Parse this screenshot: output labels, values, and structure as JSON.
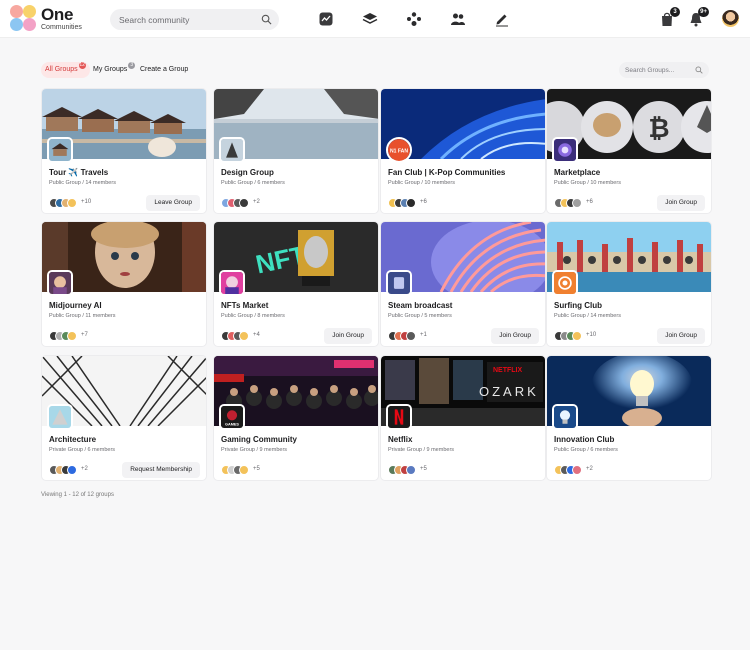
{
  "brand": {
    "name": "One",
    "subtitle": "Communities"
  },
  "search": {
    "placeholder": "Search community"
  },
  "nav_icons": [
    "activity-icon",
    "stack-icon",
    "members-icon",
    "groups-icon",
    "pen-icon"
  ],
  "actions": {
    "messages_badge": "3",
    "notifications_badge": "9+"
  },
  "filters": {
    "tabs": [
      {
        "label": "All Groups",
        "count": "12"
      },
      {
        "label": "My Groups",
        "count": "3"
      },
      {
        "label": "Create a Group"
      }
    ],
    "search_placeholder": "Search Groups..."
  },
  "groups": [
    {
      "name": "Tour ✈️ Travels",
      "meta": "Public Group / 14 members",
      "more": "+10",
      "button": "Leave Group"
    },
    {
      "name": "Design Group",
      "meta": "Public Group / 6 members",
      "more": "+2",
      "button": ""
    },
    {
      "name": "Fan Club | K-Pop Communities",
      "meta": "Public Group / 10 members",
      "more": "+6",
      "button": ""
    },
    {
      "name": "Marketplace",
      "meta": "Public Group / 10 members",
      "more": "+6",
      "button": "Join Group"
    },
    {
      "name": "Midjourney AI",
      "meta": "Public Group / 11 members",
      "more": "+7",
      "button": ""
    },
    {
      "name": "NFTs Market",
      "meta": "Public Group / 8 members",
      "more": "+4",
      "button": "Join Group"
    },
    {
      "name": "Steam broadcast",
      "meta": "Public Group / 5 members",
      "more": "+1",
      "button": "Join Group"
    },
    {
      "name": "Surfing Club",
      "meta": "Public Group / 14 members",
      "more": "+10",
      "button": "Join Group"
    },
    {
      "name": "Architecture",
      "meta": "Private Group / 6 members",
      "more": "+2",
      "button": "Request Membership"
    },
    {
      "name": "Gaming Community",
      "meta": "Private Group / 9 members",
      "more": "+5",
      "button": ""
    },
    {
      "name": "Netflix",
      "meta": "Private Group / 9 members",
      "more": "+5",
      "button": ""
    },
    {
      "name": "Innovation Club",
      "meta": "Public Group / 6 members",
      "more": "+2",
      "button": ""
    }
  ],
  "group_avatar_text": {
    "fan_club": "N1 FAN",
    "gaming": "GAMES"
  },
  "cover_text": {
    "nft": "NFT",
    "netflix": "NETFLIX",
    "ozark": "OZARK"
  },
  "footer": {
    "viewing": "Viewing 1 - 12 of 12 groups"
  },
  "colors": {
    "accent": "#d43b3b",
    "accent_bg": "#fde7e7",
    "text": "#1d1d1f",
    "muted": "#6b6b70"
  }
}
